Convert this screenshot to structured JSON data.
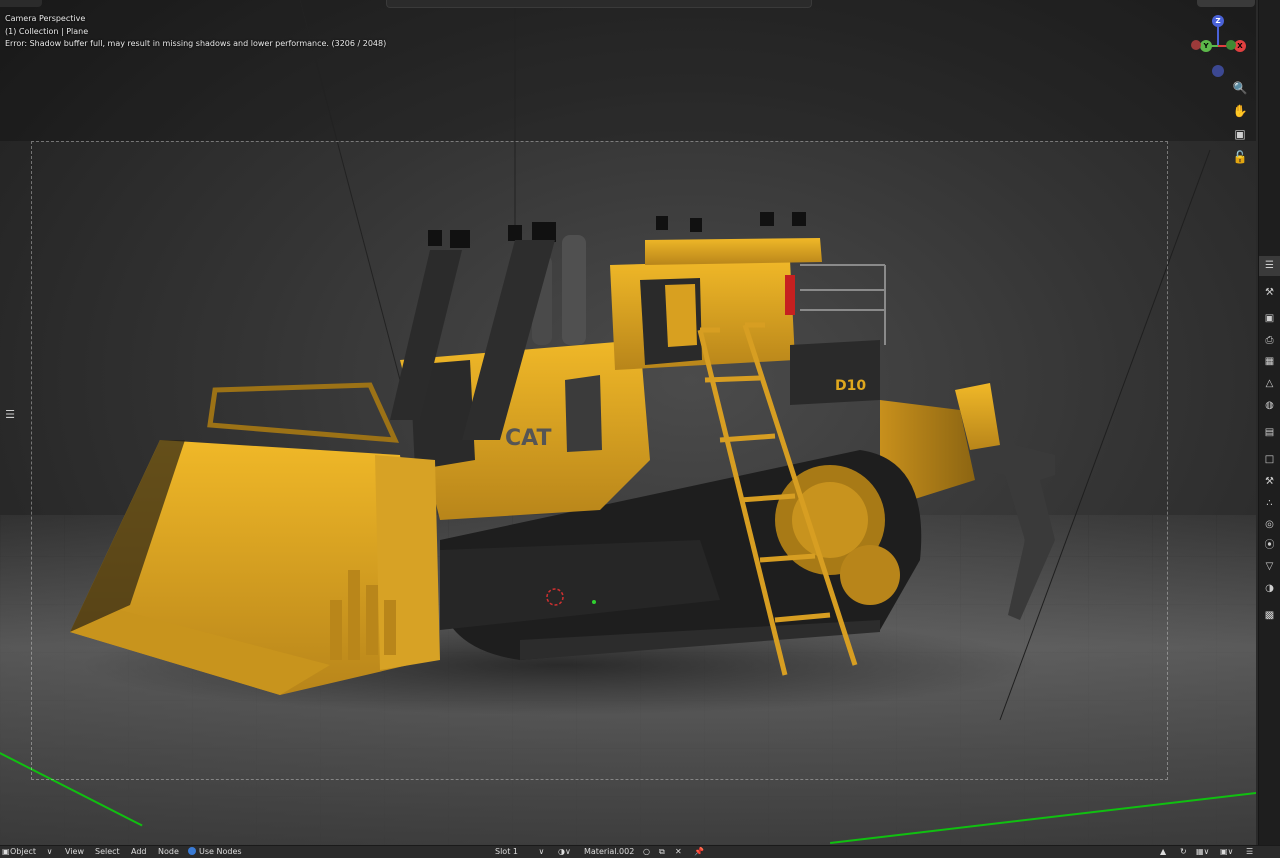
{
  "viewport": {
    "overlay_lines": [
      "Camera Perspective",
      "(1) Collection | Plane",
      "Error: Shadow buffer full, may result in missing shadows and lower performance. (3206 / 2048)"
    ],
    "decal_brand": "CAT",
    "decal_model": "D10"
  },
  "gizmo": {
    "x": "X",
    "y": "Y",
    "z": "Z"
  },
  "nav_icons": [
    "zoom-icon",
    "hand-icon",
    "camera-icon",
    "lock-icon"
  ],
  "properties_tabs": [
    "tool-icon",
    "render-icon",
    "output-icon",
    "view-layer-icon",
    "scene-icon",
    "world-icon",
    "collection-icon",
    "object-icon",
    "modifier-icon",
    "particles-icon",
    "physics-icon",
    "constraints-icon",
    "data-icon",
    "material-icon",
    "texture-icon"
  ],
  "bottom_bar": {
    "mode": "Object",
    "menu_view": "View",
    "menu_select": "Select",
    "menu_add": "Add",
    "menu_node": "Node",
    "use_nodes": "Use Nodes",
    "slot": "Slot 1",
    "material": "Material.002"
  },
  "colors": {
    "machine_yellow": "#e0a81e",
    "axis_x": "#e04040",
    "axis_y": "#5cb84a",
    "axis_z": "#4a62d8",
    "floor_axis_line": "#10c010",
    "accent_blue": "#3a7bd5"
  }
}
